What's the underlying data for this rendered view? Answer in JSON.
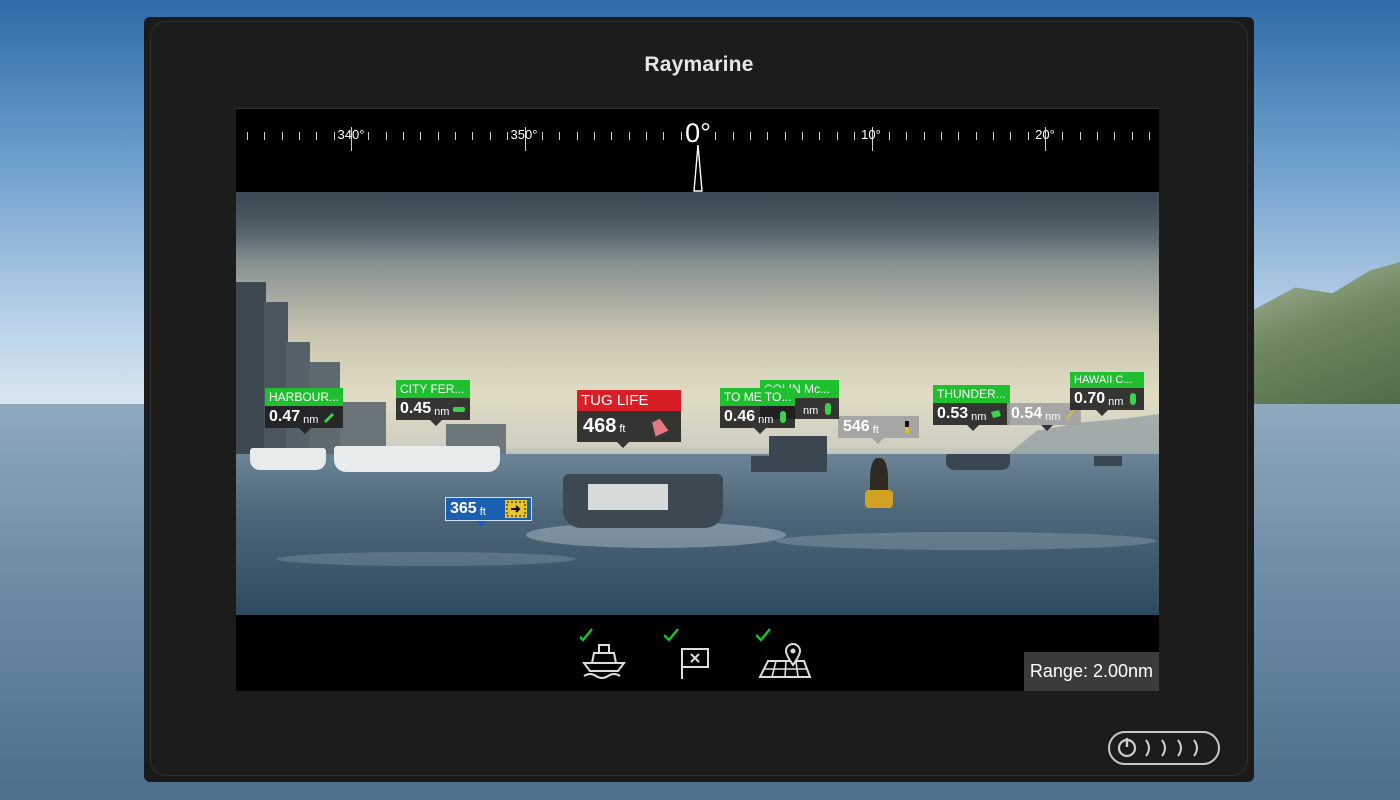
{
  "device": {
    "brand": "Raymarine"
  },
  "compass": {
    "labels": {
      "l340": "340°",
      "l350": "350°",
      "center": "0°",
      "l10": "10°",
      "l20": "20°"
    }
  },
  "targets": {
    "harbour": {
      "title": "HARBOUR...",
      "value": "0.47",
      "unit": "nm",
      "icon": "ship-icon"
    },
    "cityfer": {
      "title": "CITY FER...",
      "value": "0.45",
      "unit": "nm",
      "icon": "ship-icon"
    },
    "tuglife": {
      "title": "TUG LIFE",
      "value": "468",
      "unit": "ft",
      "icon": "buoy-marker-icon"
    },
    "tome": {
      "title": "TO ME TO...",
      "value": "0.46",
      "unit": "nm",
      "icon": "ship-icon"
    },
    "colin": {
      "title": "COLIN Mc...",
      "value": "",
      "unit": "nm",
      "icon": "ship-icon"
    },
    "buoy546": {
      "title": "",
      "value": "546",
      "unit": "ft",
      "icon": "cardinal-buoy-icon"
    },
    "thunder": {
      "title": "THUNDER...",
      "value": "0.53",
      "unit": "nm",
      "icon": "ship-icon"
    },
    "target054": {
      "title": "",
      "value": "0.54",
      "unit": "nm",
      "icon": "ship-icon"
    },
    "hawaii": {
      "title": "HAWAII C...",
      "value": "0.70",
      "unit": "nm",
      "icon": "ship-icon"
    },
    "depth365": {
      "title": "",
      "value": "365",
      "unit": "ft",
      "icon": "danger-marker-icon"
    }
  },
  "bottom": {
    "icons": [
      "ais-vessel-icon",
      "waypoint-flag-icon",
      "chart-layer-icon"
    ],
    "range": "Range: 2.00nm"
  },
  "colors": {
    "ais_green": "#1fbf2f",
    "alert_red": "#d81e26",
    "depth_blue": "#1b5fb0"
  }
}
